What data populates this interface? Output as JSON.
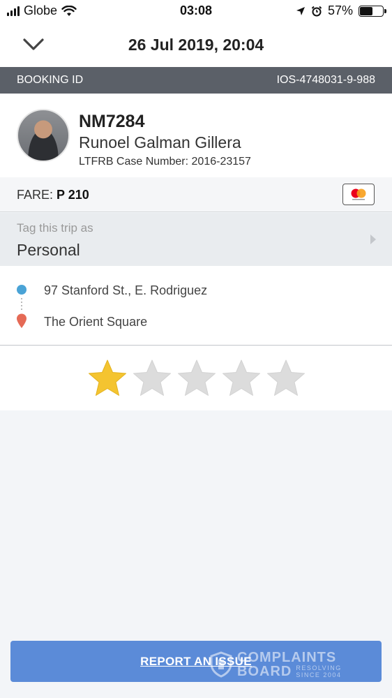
{
  "status_bar": {
    "carrier": "Globe",
    "time": "03:08",
    "battery_percent": "57%",
    "battery_level": 0.57,
    "icons": [
      "signal-icon",
      "wifi-icon",
      "location-arrow-icon",
      "alarm-icon",
      "battery-icon"
    ]
  },
  "header": {
    "title": "26 Jul 2019, 20:04",
    "back_icon": "chevron-down-icon"
  },
  "booking": {
    "label": "BOOKING ID",
    "id": "IOS-4748031-9-988"
  },
  "driver": {
    "plate": "NM7284",
    "name": "Runoel Galman Gillera",
    "case_number": "LTFRB Case Number: 2016-23157"
  },
  "fare": {
    "label": "FARE:",
    "amount": "P 210",
    "payment_icon": "mastercard-icon"
  },
  "tag": {
    "label": "Tag this trip as",
    "value": "Personal"
  },
  "route": {
    "pickup": "97 Stanford St., E. Rodriguez",
    "dropoff": "The Orient Square"
  },
  "rating": {
    "value": 1,
    "max": 5,
    "filled_color": "#f4c430",
    "empty_color": "#dcdcdc"
  },
  "report_button": {
    "label": "REPORT AN ISSUE",
    "color": "#5b8bd8"
  },
  "watermark": {
    "line1": "COMPLAINTS",
    "line2": "BOARD",
    "tagline1": "RESOLVING",
    "tagline2": "SINCE 2004"
  }
}
